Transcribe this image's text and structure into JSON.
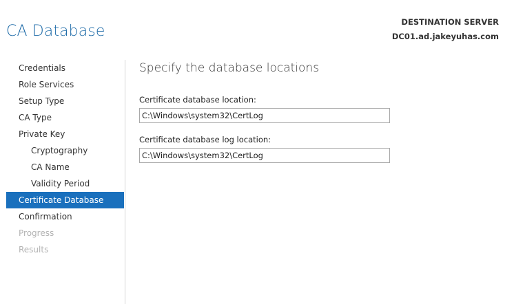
{
  "page": {
    "title": "CA Database",
    "destination_label": "DESTINATION SERVER",
    "destination_server": "DC01.ad.jakeyuhas.com"
  },
  "sidebar": {
    "items": [
      {
        "label": "Credentials",
        "state": "normal",
        "level": 0
      },
      {
        "label": "Role Services",
        "state": "normal",
        "level": 0
      },
      {
        "label": "Setup Type",
        "state": "normal",
        "level": 0
      },
      {
        "label": "CA Type",
        "state": "normal",
        "level": 0
      },
      {
        "label": "Private Key",
        "state": "normal",
        "level": 0
      },
      {
        "label": "Cryptography",
        "state": "normal",
        "level": 1
      },
      {
        "label": "CA Name",
        "state": "normal",
        "level": 1
      },
      {
        "label": "Validity Period",
        "state": "normal",
        "level": 1
      },
      {
        "label": "Certificate Database",
        "state": "active",
        "level": 0
      },
      {
        "label": "Confirmation",
        "state": "normal",
        "level": 0
      },
      {
        "label": "Progress",
        "state": "disabled",
        "level": 0
      },
      {
        "label": "Results",
        "state": "disabled",
        "level": 0
      }
    ]
  },
  "main": {
    "heading": "Specify the database locations",
    "db_location_label": "Certificate database location:",
    "db_location_value": "C:\\Windows\\system32\\CertLog",
    "log_location_label": "Certificate database log location:",
    "log_location_value": "C:\\Windows\\system32\\CertLog"
  },
  "colors": {
    "title": "#1e6ba8",
    "active_nav_bg": "#1a70bd",
    "disabled_text": "#b3b3b3"
  }
}
